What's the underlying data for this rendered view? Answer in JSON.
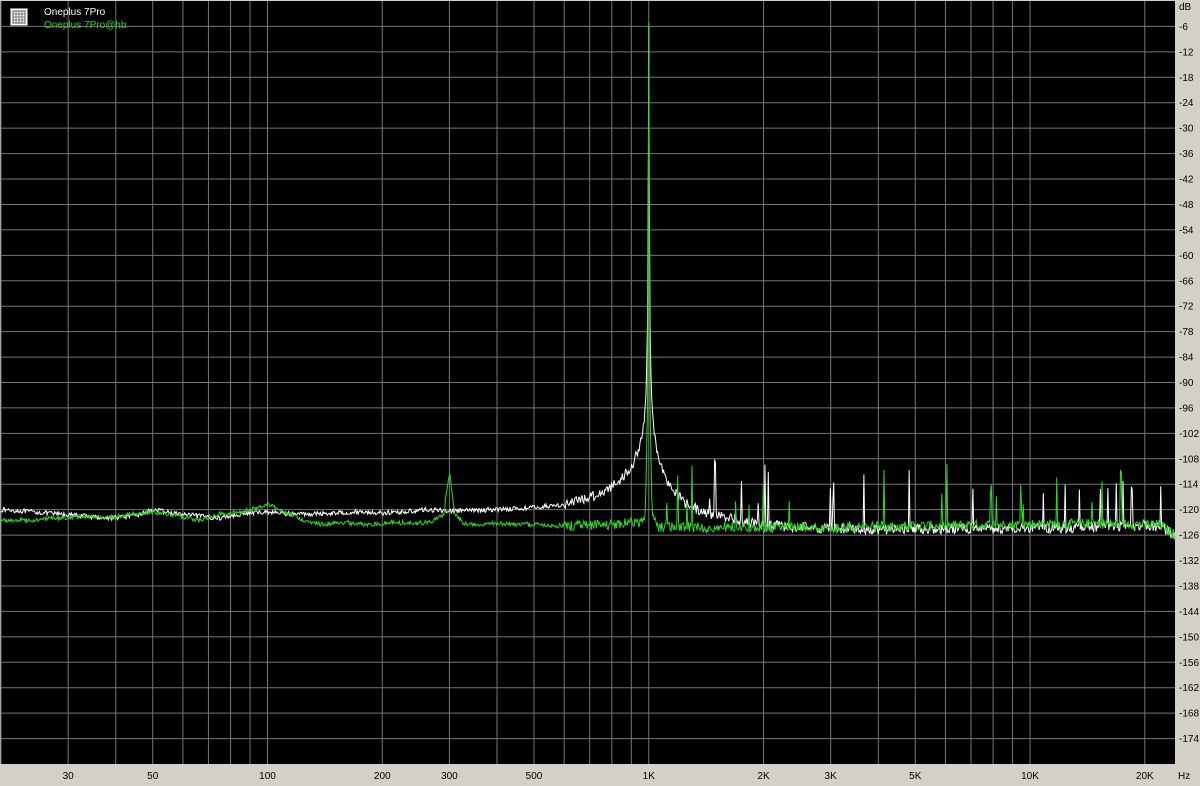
{
  "chart_data": {
    "type": "line",
    "x_scale": "log",
    "xlim": [
      20,
      24000
    ],
    "ylim": [
      -180,
      0
    ],
    "xlabel": "",
    "ylabel": "",
    "y_unit": "dB",
    "x_unit": "Hz",
    "grid": true,
    "legend_position": "top-left",
    "x_ticks": [
      {
        "value": 30,
        "label": "30"
      },
      {
        "value": 50,
        "label": "50"
      },
      {
        "value": 100,
        "label": "100"
      },
      {
        "value": 200,
        "label": "200"
      },
      {
        "value": 300,
        "label": "300"
      },
      {
        "value": 500,
        "label": "500"
      },
      {
        "value": 1000,
        "label": "1K"
      },
      {
        "value": 2000,
        "label": "2K"
      },
      {
        "value": 3000,
        "label": "3K"
      },
      {
        "value": 5000,
        "label": "5K"
      },
      {
        "value": 10000,
        "label": "10K"
      },
      {
        "value": 20000,
        "label": "20K"
      }
    ],
    "y_ticks": [
      -6,
      -12,
      -18,
      -24,
      -30,
      -36,
      -42,
      -48,
      -54,
      -60,
      -66,
      -72,
      -78,
      -84,
      -90,
      -96,
      -102,
      -108,
      -114,
      -120,
      -126,
      -132,
      -138,
      -144,
      -150,
      -156,
      -162,
      -168,
      -174
    ],
    "series": [
      {
        "name": "Oneplus 7Pro",
        "color": "#ffffff",
        "x": [
          20,
          24,
          28,
          33,
          38,
          45,
          50,
          58,
          66,
          75,
          85,
          100,
          115,
          130,
          150,
          175,
          200,
          230,
          260,
          300,
          340,
          380,
          430,
          480,
          540,
          600,
          650,
          700,
          750,
          800,
          850,
          900,
          940,
          970,
          985,
          995,
          1000,
          1005,
          1015,
          1030,
          1060,
          1100,
          1150,
          1250,
          1400,
          1600,
          1800,
          2000,
          2300,
          2600,
          3000,
          3500,
          4000,
          5000,
          6000,
          7000,
          8000,
          10000,
          12000,
          15000,
          18000,
          20000,
          22000,
          24000
        ],
        "y": [
          -120,
          -120.5,
          -121,
          -121.5,
          -122,
          -121.5,
          -120,
          -121,
          -121.5,
          -122,
          -121,
          -120.5,
          -121,
          -121,
          -120.8,
          -120.5,
          -120.8,
          -120.5,
          -120,
          -120.3,
          -120.2,
          -120,
          -119.8,
          -119.6,
          -119.2,
          -118.8,
          -118,
          -117,
          -116,
          -114.5,
          -112.5,
          -110,
          -106,
          -100,
          -92,
          -70,
          -6,
          -70,
          -92,
          -101,
          -108,
          -112,
          -115,
          -118.5,
          -120.8,
          -122,
          -122.8,
          -123.5,
          -124,
          -124.2,
          -124.5,
          -124.5,
          -124.7,
          -124.5,
          -124.6,
          -124.4,
          -124.5,
          -124.2,
          -124.4,
          -124,
          -123.8,
          -123.6,
          -124,
          -126
        ]
      },
      {
        "name": "Oneplus 7Pro@hb",
        "color": "#34d42a",
        "x": [
          20,
          24,
          28,
          33,
          38,
          45,
          50,
          58,
          66,
          75,
          85,
          95,
          100,
          110,
          125,
          140,
          160,
          180,
          210,
          240,
          270,
          290,
          295,
          300,
          305,
          310,
          330,
          360,
          400,
          450,
          500,
          560,
          620,
          700,
          780,
          850,
          900,
          950,
          980,
          995,
          1000,
          1005,
          1020,
          1050,
          1100,
          1200,
          1400,
          1700,
          2000,
          2400,
          2800,
          3200,
          3600,
          4000,
          5000,
          6000,
          7000,
          8000,
          10000,
          12000,
          15000,
          18000,
          20000,
          22000,
          24000
        ],
        "y": [
          -122.5,
          -122.5,
          -122,
          -121.5,
          -122,
          -121,
          -120.5,
          -121.5,
          -122.5,
          -121,
          -120.5,
          -119.5,
          -118.5,
          -120.5,
          -122.5,
          -123.5,
          -123,
          -123.5,
          -123,
          -123.2,
          -123,
          -121,
          -116,
          -111,
          -116,
          -121,
          -123.5,
          -123.5,
          -123.2,
          -123.5,
          -123.5,
          -123.8,
          -123.8,
          -123.5,
          -123.5,
          -123.2,
          -123,
          -123,
          -121,
          -90,
          -5,
          -90,
          -121,
          -124.2,
          -124.2,
          -124,
          -124.3,
          -124,
          -124.2,
          -124,
          -124.2,
          -124.2,
          -124,
          -124,
          -123.8,
          -123.8,
          -123.6,
          -123.6,
          -123.4,
          -123.4,
          -123.3,
          -123.3,
          -123.5,
          -123.6,
          -126
        ]
      }
    ]
  }
}
